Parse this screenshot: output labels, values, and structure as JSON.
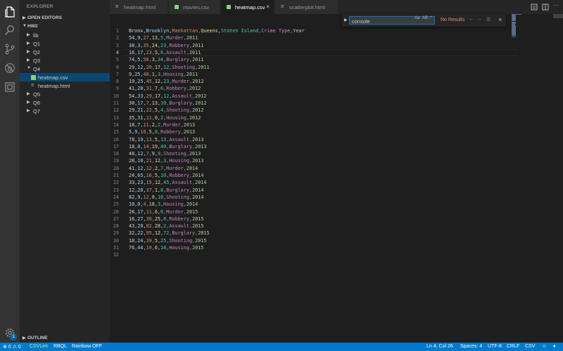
{
  "activity_bar": {
    "icons": [
      "files-icon",
      "search-icon",
      "source-control-icon",
      "debug-icon",
      "extensions-icon",
      "settings-gear-icon"
    ],
    "settings_badge": "1"
  },
  "sidebar": {
    "title": "EXPLORER",
    "open_editors_label": "OPEN EDITORS",
    "workspace_label": "HW2",
    "outline_label": "OUTLINE",
    "tree": [
      {
        "label": "lib",
        "kind": "folder",
        "expanded": false
      },
      {
        "label": "Q1",
        "kind": "folder",
        "expanded": false
      },
      {
        "label": "Q2",
        "kind": "folder",
        "expanded": false
      },
      {
        "label": "Q3",
        "kind": "folder",
        "expanded": false
      },
      {
        "label": "Q4",
        "kind": "folder",
        "expanded": true
      },
      {
        "label": "heatmap.csv",
        "kind": "csv",
        "selected": true
      },
      {
        "label": "heatmap.html",
        "kind": "html"
      },
      {
        "label": "Q5",
        "kind": "folder",
        "expanded": false
      },
      {
        "label": "Q6",
        "kind": "folder",
        "expanded": false
      },
      {
        "label": "Q7",
        "kind": "folder",
        "expanded": false
      }
    ]
  },
  "tabs": [
    {
      "label": "heatmap.html",
      "kind": "html",
      "active": false
    },
    {
      "label": "movies.csv",
      "kind": "csv",
      "active": false
    },
    {
      "label": "heatmap.csv",
      "kind": "csv",
      "active": true
    },
    {
      "label": "scatterplot.html",
      "kind": "html",
      "active": false
    }
  ],
  "find_widget": {
    "query": "console",
    "options": [
      "Aa",
      "AB",
      ".*"
    ],
    "result_text": "No Results"
  },
  "editor": {
    "current_line": 4,
    "lines": [
      "Bronx,Brooklyn,Manhattan,Queens,Staten Island,Crime Type,Year",
      "54,9,27,13,5,Murder,2011",
      "38,3,35,24,23,Robbery,2011",
      "16,17,23,5,6,Assault,2011",
      "74,5,56,3,34,Burglary,2011",
      "29,12,20,17,12,Shooting,2011",
      "9,25,40,1,3,Housing,2011",
      "19,25,45,12,23,Murder,2012",
      "41,20,31,7,6,Robbery,2012",
      "54,33,29,17,12,Assault,2012",
      "30,17,7,13,10,Burglary,2012",
      "29,21,22,5,4,Shooting,2012",
      "35,31,11,0,2,Housing,2012",
      "18,7,11,2,2,Murder,2013",
      "5,9,16,5,0,Robbery,2013",
      "78,19,13,5,13,Assault,2013",
      "18,0,14,19,40,Burglary,2013",
      "48,12,7,9,9,Shooting,2013",
      "28,10,21,12,3,Housing,2013",
      "41,12,12,2,7,Murder,2014",
      "24,65,16,5,10,Robbery,2014",
      "33,23,15,12,45,Assault,2014",
      "12,20,37,1,8,Burglary,2014",
      "82,9,12,0,10,Shooting,2014",
      "10,0,4,18,3,Housing,2014",
      "26,17,11,6,0,Murder,2015",
      "16,27,30,25,0,Robbery,2015",
      "43,20,82,28,2,Assault,2015",
      "32,22,95,12,72,Burglary,2015",
      "18,24,39,5,25,Shooting,2015",
      "76,44,19,6,18,Housing,2015",
      ""
    ]
  },
  "status_bar": {
    "errors": "0",
    "warnings": "0",
    "csvlint": "CSVLint",
    "rbql": "RBQL",
    "rainbow": "Rainbow OFF",
    "position": "Ln 4, Col 26",
    "spaces": "Spaces: 4",
    "encoding": "UTF-8",
    "eol": "CRLF",
    "language": "CSV"
  },
  "colors": {
    "rainbow": [
      "#d4d4d4",
      "#9cdcfe",
      "#ce9178",
      "#dcdcaa",
      "#4ec9b0",
      "#c586c0",
      "#b5cea8"
    ],
    "statusbar_bg": "#007acc",
    "selected_bg": "#094771"
  }
}
